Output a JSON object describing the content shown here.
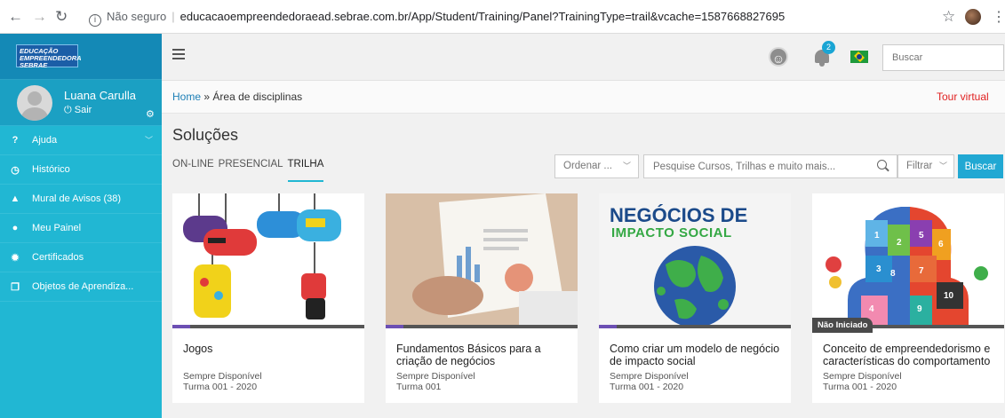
{
  "browser": {
    "security": "Não seguro",
    "url": "educacaoempreendedoraead.sebrae.com.br/App/Student/Training/Panel?TrainingType=trail&vcache=1587668827695"
  },
  "logo": {
    "line1": "EDUCAÇÃO",
    "line2": "EMPREENDEDORA",
    "line3": "SEBRAE"
  },
  "user": {
    "name": "Luana Carulla",
    "logout": "Sair"
  },
  "sidebar": {
    "items": [
      {
        "label": "Ajuda",
        "icon": "help-icon"
      },
      {
        "label": "Histórico",
        "icon": "history-icon"
      },
      {
        "label": "Mural de Avisos (38)",
        "icon": "warning-icon"
      },
      {
        "label": "Meu Painel",
        "icon": "user-icon"
      },
      {
        "label": "Certificados",
        "icon": "certificate-icon"
      },
      {
        "label": "Objetos de Aprendiza...",
        "icon": "objects-icon"
      }
    ]
  },
  "header": {
    "notification_count": "2",
    "search_placeholder": "Buscar"
  },
  "breadcrumb": {
    "home": "Home",
    "separator": "»",
    "current": "Área de disciplinas",
    "tour": "Tour virtual"
  },
  "page": {
    "title": "Soluções",
    "tabs": [
      "ON-LINE",
      "PRESENCIAL",
      "TRILHA"
    ],
    "active_tab": "TRILHA",
    "order_label": "Ordenar ...",
    "search_placeholder": "Pesquise Cursos, Trilhas e muito mais...",
    "filter_label": "Filtrar",
    "search_button": "Buscar"
  },
  "thumbs": {
    "card3_line1": "NEGÓCIOS DE",
    "card3_line2": "IMPACTO SOCIAL",
    "card4_numbers": [
      "1",
      "2",
      "3",
      "4",
      "5",
      "6",
      "7",
      "8",
      "9",
      "10"
    ]
  },
  "cards": [
    {
      "title": "Jogos",
      "availability": "Sempre Disponível",
      "class": "Turma 001 - 2020",
      "status": ""
    },
    {
      "title": "Fundamentos Básicos para a criação de negócios",
      "availability": "Sempre Disponível",
      "class": "Turma 001",
      "status": ""
    },
    {
      "title": "Como criar um modelo de negócio de impacto social",
      "availability": "Sempre Disponível",
      "class": "Turma 001 - 2020",
      "status": ""
    },
    {
      "title": "Conceito de empreendedorismo e características do comportamento",
      "availability": "Sempre Disponível",
      "class": "Turma 001 - 2020",
      "status": "Não Iniciado"
    }
  ]
}
